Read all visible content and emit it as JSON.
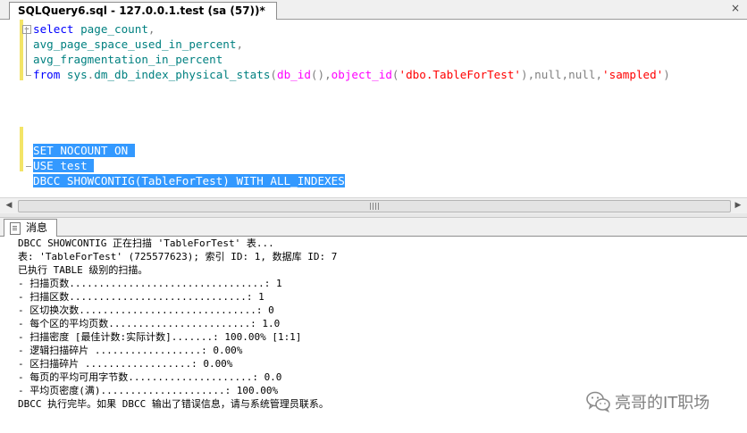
{
  "tab": {
    "title": "SQLQuery6.sql - 127.0.0.1.test (sa (57))*",
    "close_glyph": "×"
  },
  "editor": {
    "lines": [
      {
        "parts": [
          {
            "t": "select ",
            "c": "kw"
          },
          {
            "t": "page_count",
            "c": "txt"
          },
          {
            "t": ",",
            "c": "gray"
          }
        ]
      },
      {
        "parts": [
          {
            "t": "avg_page_space_used_in_percent",
            "c": "txt"
          },
          {
            "t": ",",
            "c": "gray"
          }
        ]
      },
      {
        "parts": [
          {
            "t": "avg_fragmentation_in_percent",
            "c": "txt"
          }
        ]
      },
      {
        "parts": [
          {
            "t": "from ",
            "c": "kw"
          },
          {
            "t": "sys",
            "c": "fn"
          },
          {
            "t": ".",
            "c": "gray"
          },
          {
            "t": "dm_db_index_physical_stats",
            "c": "fn"
          },
          {
            "t": "(",
            "c": "gray"
          },
          {
            "t": "db_id",
            "c": "fn2"
          },
          {
            "t": "(),",
            "c": "gray"
          },
          {
            "t": "object_id",
            "c": "fn2"
          },
          {
            "t": "(",
            "c": "gray"
          },
          {
            "t": "'dbo.TableForTest'",
            "c": "str"
          },
          {
            "t": "),",
            "c": "gray"
          },
          {
            "t": "null",
            "c": "gray"
          },
          {
            "t": ",",
            "c": "gray"
          },
          {
            "t": "null",
            "c": "gray"
          },
          {
            "t": ",",
            "c": "gray"
          },
          {
            "t": "'sampled'",
            "c": "str"
          },
          {
            "t": ")",
            "c": "gray"
          }
        ]
      },
      {
        "parts": []
      },
      {
        "parts": []
      },
      {
        "parts": []
      },
      {
        "parts": []
      },
      {
        "parts": [
          {
            "t": "SET NOCOUNT ON ",
            "c": "sel"
          }
        ]
      },
      {
        "parts": [
          {
            "t": "USE test ",
            "c": "sel"
          }
        ]
      },
      {
        "parts": [
          {
            "t": "DBCC SHOWCONTIG(TableForTest) WITH ALL_INDEXES",
            "c": "sel"
          }
        ]
      }
    ]
  },
  "results": {
    "tab_label": "消息",
    "messages": [
      "DBCC SHOWCONTIG 正在扫描 'TableForTest' 表...",
      "表: 'TableForTest' (725577623); 索引 ID: 1, 数据库 ID: 7",
      "已执行 TABLE 级别的扫描。",
      "- 扫描页数.................................: 1",
      "- 扫描区数..............................: 1",
      "- 区切换次数..............................: 0",
      "- 每个区的平均页数........................: 1.0",
      "- 扫描密度 [最佳计数:实际计数].......: 100.00% [1:1]",
      "- 逻辑扫描碎片 ..................: 0.00%",
      "- 区扫描碎片 ..................: 0.00%",
      "- 每页的平均可用字节数.....................: 0.0",
      "- 平均页密度(满).....................: 100.00%",
      "DBCC 执行完毕。如果 DBCC 输出了错误信息，请与系统管理员联系。"
    ]
  },
  "watermark": {
    "text": "亮哥的IT职场",
    "icon": "wechat-icon"
  }
}
